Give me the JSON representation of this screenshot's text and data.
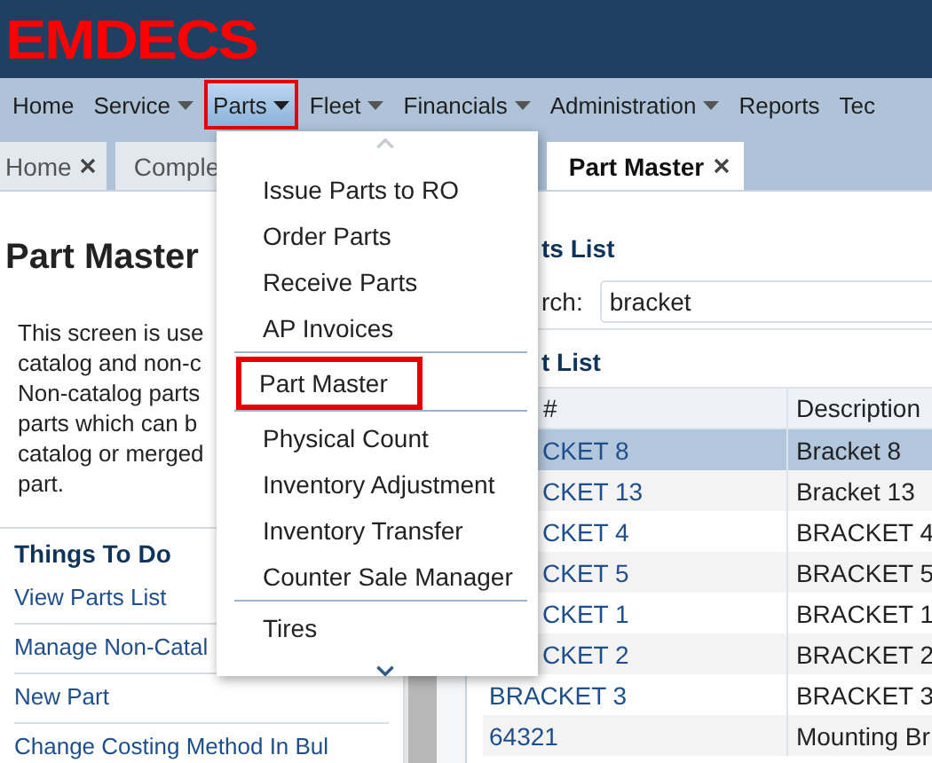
{
  "logo": "EMDECS",
  "nav": [
    {
      "label": "Home",
      "has_menu": false,
      "selected": false
    },
    {
      "label": "Service",
      "has_menu": true,
      "selected": false
    },
    {
      "label": "Parts",
      "has_menu": true,
      "selected": true
    },
    {
      "label": "Fleet",
      "has_menu": true,
      "selected": false
    },
    {
      "label": "Financials",
      "has_menu": true,
      "selected": false
    },
    {
      "label": "Administration",
      "has_menu": true,
      "selected": false
    },
    {
      "label": "Reports",
      "has_menu": false,
      "selected": false
    },
    {
      "label": "Tec",
      "has_menu": false,
      "selected": false
    }
  ],
  "tabs": [
    {
      "label": "Home",
      "selected": false,
      "closable": true
    },
    {
      "label": "Comple",
      "selected": false,
      "closable": false
    },
    {
      "label": "Part Master",
      "selected": true,
      "closable": true
    }
  ],
  "left_panel": {
    "title": "Part Master",
    "description_lines": [
      "This screen is use",
      "catalog and non-c",
      "Non-catalog parts",
      "parts which can b",
      "catalog or merged",
      "part."
    ],
    "things_to_do": {
      "title": "Things To Do",
      "links": [
        "View Parts List",
        "Manage Non-Catal",
        "New Part",
        "Change Costing Method In Bul"
      ]
    }
  },
  "right_panel": {
    "heading": "ts List",
    "search_label": "rch:",
    "search_value": "bracket",
    "list_heading": "t List",
    "table": {
      "columns": [
        "#",
        "Description"
      ],
      "rows": [
        {
          "cells": [
            "CKET 8",
            "Bracket 8"
          ],
          "selected": true
        },
        {
          "cells": [
            "CKET 13",
            "Bracket 13"
          ],
          "selected": false
        },
        {
          "cells": [
            "CKET 4",
            "BRACKET 4"
          ],
          "selected": false
        },
        {
          "cells": [
            "CKET 5",
            "BRACKET 5"
          ],
          "selected": false
        },
        {
          "cells": [
            "CKET 1",
            "BRACKET 1"
          ],
          "selected": false
        },
        {
          "cells": [
            "CKET 2",
            "BRACKET 2"
          ],
          "selected": false
        },
        {
          "cells": [
            "BRACKET 3",
            "BRACKET 3"
          ],
          "selected": false
        },
        {
          "cells": [
            "64321",
            "Mounting Br"
          ],
          "selected": false
        }
      ]
    }
  },
  "parts_menu": {
    "groups": [
      {
        "items": [
          {
            "label": "Issue Parts to RO",
            "selected": false
          },
          {
            "label": "Order Parts",
            "selected": false
          },
          {
            "label": "Receive Parts",
            "selected": false
          },
          {
            "label": "AP Invoices",
            "selected": false
          }
        ]
      },
      {
        "items": [
          {
            "label": "Part Master",
            "selected": true
          }
        ]
      },
      {
        "items": [
          {
            "label": "Physical Count",
            "selected": false
          },
          {
            "label": "Inventory Adjustment",
            "selected": false
          },
          {
            "label": "Inventory Transfer",
            "selected": false
          },
          {
            "label": "Counter Sale Manager",
            "selected": false
          }
        ]
      },
      {
        "items": [
          {
            "label": "Tires",
            "selected": false
          }
        ]
      }
    ]
  }
}
